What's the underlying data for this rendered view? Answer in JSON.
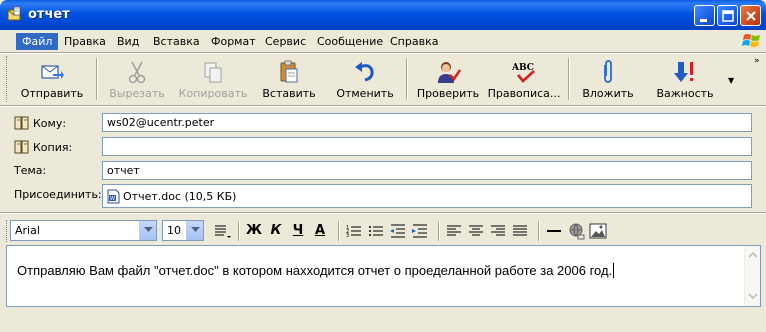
{
  "window": {
    "title": "отчет"
  },
  "menu": {
    "items": [
      "Файл",
      "Правка",
      "Вид",
      "Вставка",
      "Формат",
      "Сервис",
      "Сообщение",
      "Справка"
    ]
  },
  "toolbar": {
    "send": "Отправить",
    "cut": "Вырезать",
    "copy": "Копировать",
    "paste": "Вставить",
    "undo": "Отменить",
    "check": "Проверить",
    "spelling": "Правописа...",
    "attach": "Вложить",
    "priority": "Важность",
    "spelling_icon_text": "ABC"
  },
  "header": {
    "to_label": "Кому:",
    "to_value": "ws02@ucentr.peter",
    "cc_label": "Копия:",
    "cc_value": "",
    "subject_label": "Тема:",
    "subject_value": "отчет",
    "attach_label": "Присоединить:",
    "attachment": "Отчет.doc (10,5 КБ)"
  },
  "format": {
    "font": "Arial",
    "size": "10",
    "bold": "Ж",
    "italic": "К",
    "underline": "Ч",
    "color": "А"
  },
  "message": {
    "body": "Отправляю Вам файл \"отчет.doc\" в котором нахходится отчет о проеделанной работе за 2006 год."
  },
  "colors": {
    "titlebar": "#0054E3",
    "menu_active": "#316AC5",
    "window_bg": "#ECE9D8",
    "close_button": "#D14A1C"
  }
}
